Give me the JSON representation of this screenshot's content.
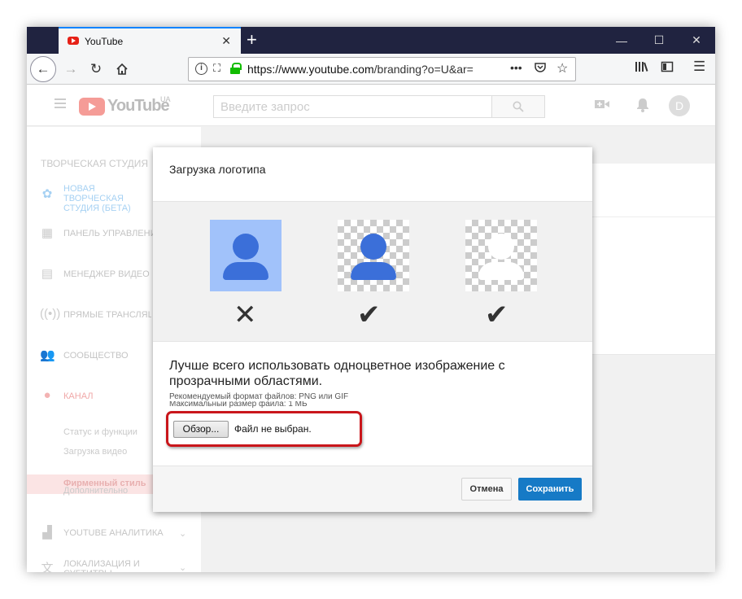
{
  "browser": {
    "tab_title": "YouTube",
    "tab_close": "✕",
    "new_tab": "+",
    "url_host": "https://www.youtube.com",
    "url_path": "/branding?o=U&ar=",
    "page_actions": "•••",
    "window_controls": {
      "minimize": "—",
      "maximize": "☐",
      "close": "✕"
    }
  },
  "youtube_header": {
    "logo_text": "YouTube",
    "region": "UA",
    "search_placeholder": "Введите запрос",
    "avatar_letter": "D"
  },
  "sidebar": {
    "title": "ТВОРЧЕСКАЯ СТУДИЯ",
    "items": [
      {
        "label": "НОВАЯ ТВОРЧЕСКАЯ СТУДИЯ (БЕТА)",
        "icon": "gear-icon"
      },
      {
        "label": "ПАНЕЛЬ УПРАВЛЕНИЯ",
        "icon": "dashboard-icon"
      },
      {
        "label": "МЕНЕДЖЕР ВИДЕО",
        "icon": "video-manager-icon"
      },
      {
        "label": "ПРЯМЫЕ ТРАНСЛЯЦИИ",
        "icon": "live-icon"
      },
      {
        "label": "СООБЩЕСТВО",
        "icon": "community-icon"
      },
      {
        "label": "КАНАЛ",
        "icon": "channel-icon"
      }
    ],
    "channel_sub": [
      "Статус и функции",
      "Загрузка видео",
      "Фирменный стиль",
      "Дополнительно"
    ],
    "bottom_items": [
      {
        "label": "YOUTUBE АНАЛИТИКА",
        "icon": "analytics-icon"
      },
      {
        "label": "ЛОКАЛИЗАЦИЯ И СУБТИТРЫ",
        "icon": "translate-icon"
      }
    ]
  },
  "dialog": {
    "title": "Загрузка логотипа",
    "main_text": "Лучше всего использовать одноцветное изображение с прозрачными областями.",
    "hint_format": "Рекомендуемый формат файлов: PNG или GIF",
    "hint_size": "Максимальный размер файла: 1 МБ",
    "browse_label": "Обзор...",
    "file_status": "Файл не выбран.",
    "cancel_label": "Отмена",
    "save_label": "Сохранить",
    "examples": [
      {
        "mark": "✕",
        "background": "solid-blue"
      },
      {
        "mark": "✔",
        "background": "transparent"
      },
      {
        "mark": "✔",
        "background": "transparent"
      }
    ]
  },
  "colors": {
    "accent_blue": "#167ac6",
    "highlight_red": "#c9161b",
    "person_blue": "#3b6fd9"
  }
}
